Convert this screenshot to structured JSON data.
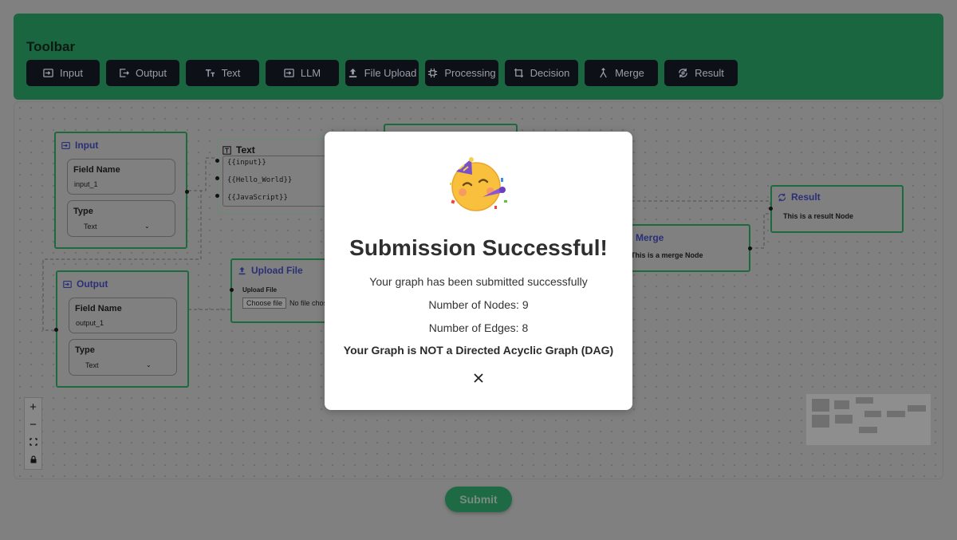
{
  "toolbar": {
    "title": "Toolbar",
    "buttons": [
      {
        "label": "Input",
        "icon": "input-icon"
      },
      {
        "label": "Output",
        "icon": "output-icon"
      },
      {
        "label": "Text",
        "icon": "text-icon"
      },
      {
        "label": "LLM",
        "icon": "llm-icon"
      },
      {
        "label": "File Upload",
        "icon": "upload-icon"
      },
      {
        "label": "Processing",
        "icon": "processing-icon"
      },
      {
        "label": "Decision",
        "icon": "decision-icon"
      },
      {
        "label": "Merge",
        "icon": "merge-icon"
      },
      {
        "label": "Result",
        "icon": "result-icon"
      }
    ]
  },
  "nodes": {
    "input": {
      "title": "Input",
      "field_label": "Field Name",
      "field_value": "input_1",
      "type_label": "Type",
      "type_value": "Text"
    },
    "output": {
      "title": "Output",
      "field_label": "Field Name",
      "field_value": "output_1",
      "type_label": "Type",
      "type_value": "Text"
    },
    "text": {
      "title": "Text",
      "lines": [
        "{{input}}",
        "{{Hello_World}}",
        "{{JavaScript}}"
      ]
    },
    "upload": {
      "title": "Upload File",
      "field_label": "Upload File",
      "button_label": "Choose file",
      "status": "No file chosen"
    },
    "result": {
      "title": "Result",
      "body": "This is a result Node"
    },
    "merge": {
      "title": "Merge",
      "body": "This is a merge Node"
    }
  },
  "controls": {
    "zoom_in": "+",
    "zoom_out": "−"
  },
  "modal": {
    "emoji": "partying-face-emoji",
    "title": "Submission Successful!",
    "message": "Your graph has been submitted successfully",
    "nodes_text": "Number of Nodes: 9",
    "edges_text": "Number of Edges: 8",
    "dag_text": "Your Graph is NOT a Directed Acyclic Graph (DAG)"
  },
  "submit_label": "Submit",
  "colors": {
    "toolbar": "#1a6641",
    "node_border": "#1d6a3e",
    "overlay": "#808080",
    "modal": "#ffffff"
  }
}
